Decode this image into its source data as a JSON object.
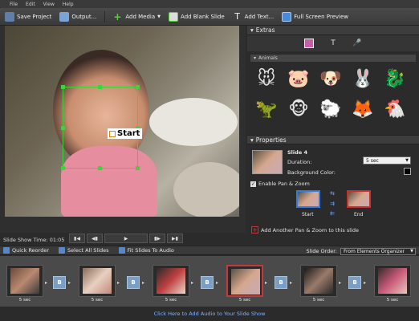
{
  "menu": [
    "File",
    "Edit",
    "View",
    "Help"
  ],
  "toolbar": {
    "save": "Save Project",
    "output": "Output...",
    "add_media": "Add Media",
    "add_blank": "Add Blank Slide",
    "add_text": "Add Text...",
    "full_screen": "Full Screen Preview"
  },
  "preview": {
    "start_label": "Start",
    "slide_show_time": "Slide Show Time: 01:05"
  },
  "extras": {
    "title": "Extras",
    "category": "Animals",
    "animals": [
      "mouse-icon",
      "pig-icon",
      "dog-icon",
      "rabbit-icon",
      "seahorse-icon",
      "dinosaur-icon",
      "monkey-icon",
      "sheep-icon",
      "fox-icon",
      "chicken-icon"
    ]
  },
  "properties": {
    "title": "Properties",
    "slide_name": "Slide 4",
    "duration_label": "Duration:",
    "duration_value": "5 sec",
    "bg_color_label": "Background Color:",
    "bg_color": "#000000",
    "enable_pz": "Enable Pan & Zoom",
    "start": "Start",
    "end": "End",
    "add_pz": "Add Another Pan & Zoom to this slide"
  },
  "strip_tools": {
    "quick_reorder": "Quick Reorder",
    "select_all": "Select All Slides",
    "fit_audio": "Fit Slides To Audio",
    "slide_order_label": "Slide Order:",
    "slide_order_value": "From Elements Organizer"
  },
  "slides": [
    {
      "dur": "5 sec"
    },
    {
      "dur": "5 sec"
    },
    {
      "dur": "5 sec"
    },
    {
      "dur": "5 sec"
    },
    {
      "dur": "5 sec"
    },
    {
      "dur": "5 sec"
    }
  ],
  "audio_prompt": "Click Here to Add Audio to Your Slide Show",
  "colors": {
    "accent": "#3cd33c",
    "selected": "#c23a3a",
    "link": "#7fb2ff"
  }
}
